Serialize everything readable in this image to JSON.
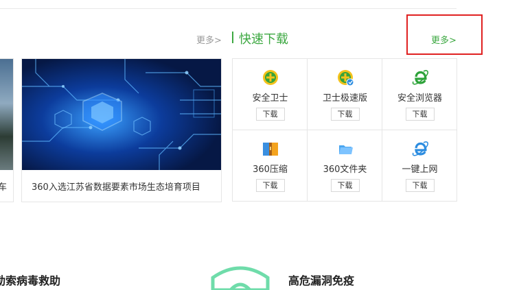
{
  "header": {
    "more_left": "更多>",
    "section_title": "快速下载",
    "more_right": "更多>"
  },
  "news": {
    "partial_caption": "车",
    "main_caption": "360入选江苏省数据要素市场生态培育项目"
  },
  "downloads": [
    {
      "label": "安全卫士",
      "button": "下载",
      "icon": "360-safe-guard-icon"
    },
    {
      "label": "卫士极速版",
      "button": "下载",
      "icon": "360-safe-speed-icon"
    },
    {
      "label": "安全浏览器",
      "button": "下载",
      "icon": "360-browser-icon"
    },
    {
      "label": "360压缩",
      "button": "下载",
      "icon": "360-zip-icon"
    },
    {
      "label": "360文件夹",
      "button": "下载",
      "icon": "360-folder-icon"
    },
    {
      "label": "一键上网",
      "button": "下载",
      "icon": "360-ie-browser-icon"
    }
  ],
  "bottom": {
    "left_title": "勒索病毒救助",
    "right_title": "高危漏洞免疫"
  },
  "colors": {
    "accent_green": "#3ca841",
    "highlight_red": "#e02020",
    "border": "#e5e5e5"
  }
}
